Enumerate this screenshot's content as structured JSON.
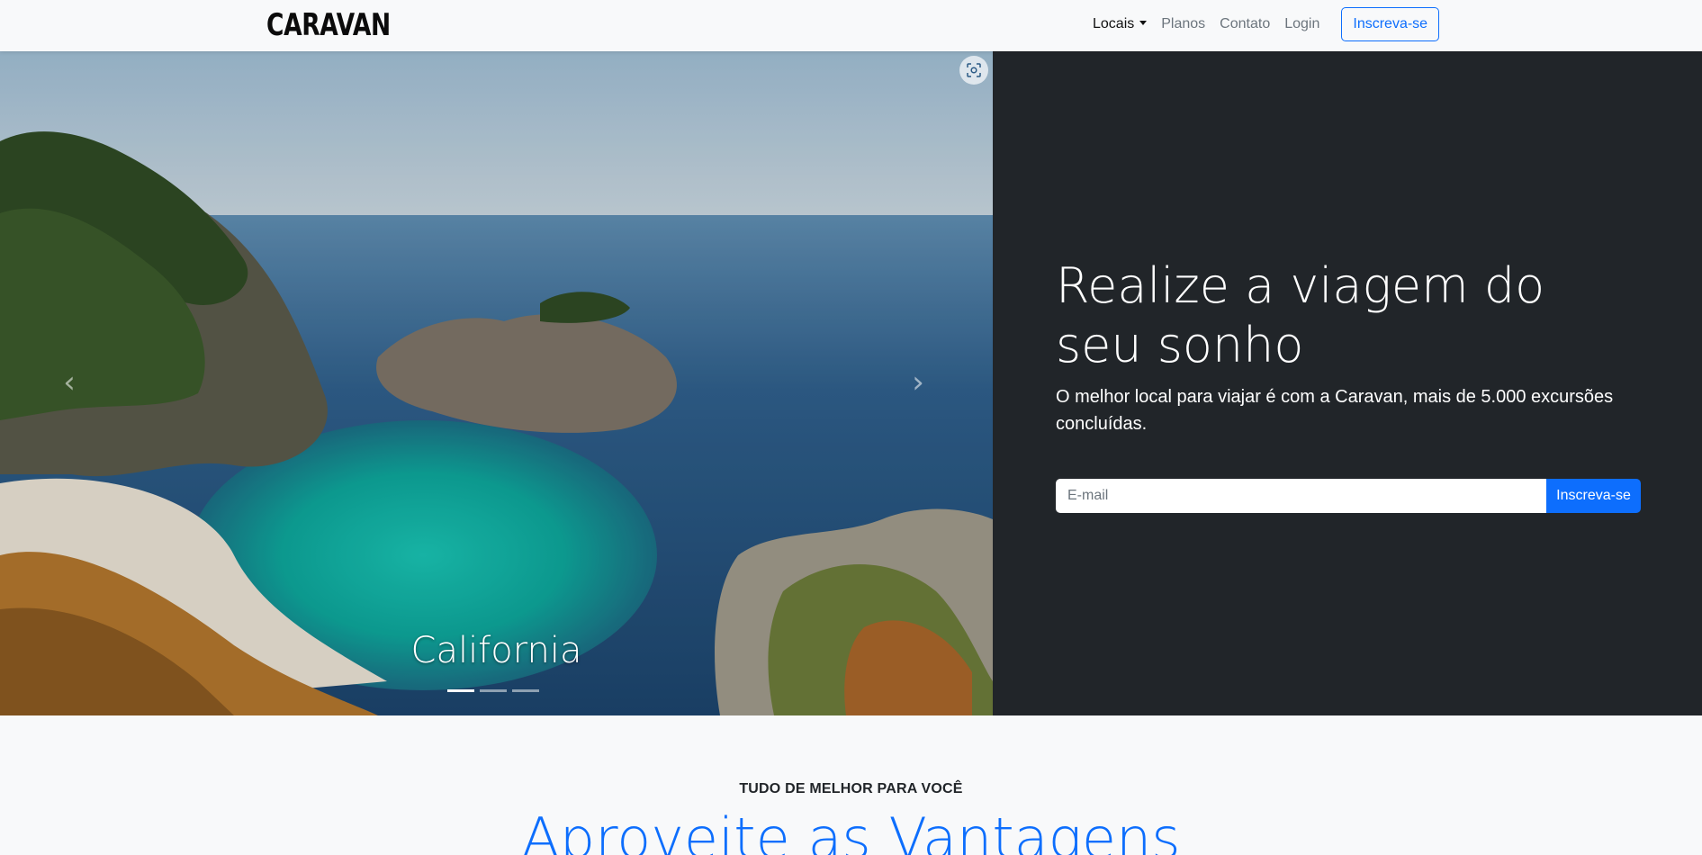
{
  "navbar": {
    "brand": "CARAVAN",
    "links": [
      {
        "label": "Locais",
        "dropdown": true
      },
      {
        "label": "Planos"
      },
      {
        "label": "Contato"
      },
      {
        "label": "Login"
      }
    ],
    "cta_label": "Inscreva-se"
  },
  "carousel": {
    "caption": "California",
    "indicator_count": 3,
    "active_index": 0,
    "prev_icon": "chevron-left-icon",
    "next_icon": "chevron-right-icon",
    "screen_icon": "screenshot-icon"
  },
  "hero": {
    "title": "Realize a viagem do seu sonho",
    "lead": "O melhor local para viajar é com a Caravan, mais de 5.000 excursões concluídas.",
    "email_placeholder": "E-mail",
    "submit_label": "Inscreva-se"
  },
  "benefits": {
    "kicker": "TUDO DE MELHOR PARA VOCÊ",
    "title": "Aproveite as Vantagens"
  },
  "colors": {
    "primary": "#0d6efd",
    "dark_panel": "#212529",
    "page_bg": "#f8f9fa"
  }
}
